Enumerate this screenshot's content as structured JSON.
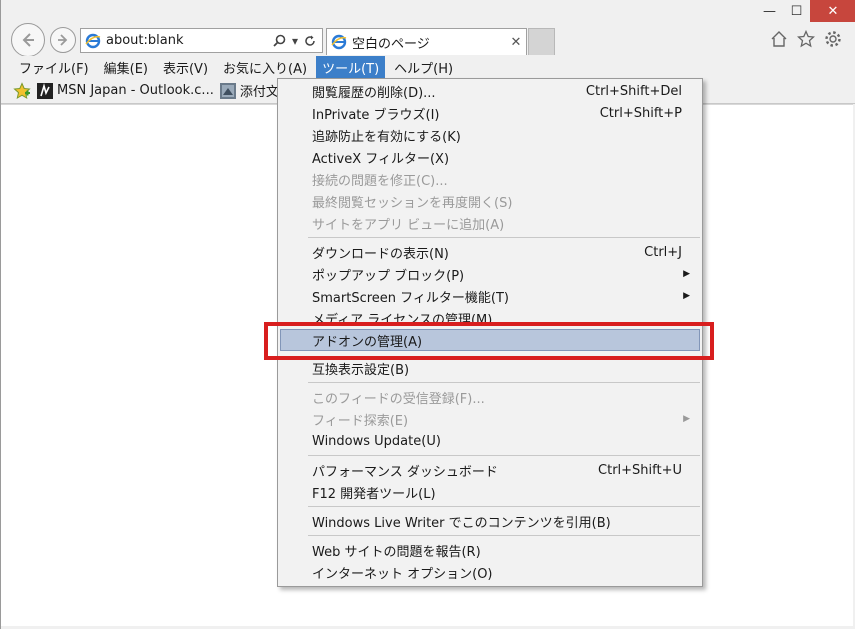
{
  "window": {
    "controls": {
      "minimize": "—",
      "maximize": "☐",
      "close": "✕"
    }
  },
  "address_bar": {
    "url": "about:blank"
  },
  "tab": {
    "title": "空白のページ",
    "close": "✕"
  },
  "menubar": {
    "items": [
      "ファイル(F)",
      "編集(E)",
      "表示(V)",
      "お気に入り(A)",
      "ツール(T)",
      "ヘルプ(H)"
    ]
  },
  "favorites": {
    "items": [
      "MSN Japan - Outlook.c...",
      "添付文書"
    ]
  },
  "tools_menu": {
    "items": [
      {
        "label": "閲覧履歴の削除(D)...",
        "shortcut": "Ctrl+Shift+Del"
      },
      {
        "label": "InPrivate ブラウズ(I)",
        "shortcut": "Ctrl+Shift+P"
      },
      {
        "label": "追跡防止を有効にする(K)",
        "shortcut": ""
      },
      {
        "label": "ActiveX フィルター(X)",
        "shortcut": ""
      },
      {
        "label": "接続の問題を修正(C)...",
        "shortcut": ""
      },
      {
        "label": "最終閲覧セッションを再度開く(S)",
        "shortcut": ""
      },
      {
        "label": "サイトをアプリ ビューに追加(A)",
        "shortcut": ""
      },
      {
        "label": "ダウンロードの表示(N)",
        "shortcut": "Ctrl+J"
      },
      {
        "label": "ポップアップ ブロック(P)",
        "shortcut": ""
      },
      {
        "label": "SmartScreen フィルター機能(T)",
        "shortcut": ""
      },
      {
        "label": "メディア ライセンスの管理(M)",
        "shortcut": ""
      },
      {
        "label": "アドオンの管理(A)",
        "shortcut": ""
      },
      {
        "label": "互換表示設定(B)",
        "shortcut": ""
      },
      {
        "label": "このフィードの受信登録(F)...",
        "shortcut": ""
      },
      {
        "label": "フィード探索(E)",
        "shortcut": ""
      },
      {
        "label": "Windows Update(U)",
        "shortcut": ""
      },
      {
        "label": "パフォーマンス ダッシュボード",
        "shortcut": "Ctrl+Shift+U"
      },
      {
        "label": "F12 開発者ツール(L)",
        "shortcut": ""
      },
      {
        "label": "Windows Live Writer でこのコンテンツを引用(B)",
        "shortcut": ""
      },
      {
        "label": "Web サイトの問題を報告(R)",
        "shortcut": ""
      },
      {
        "label": "インターネット オプション(O)",
        "shortcut": ""
      }
    ]
  },
  "colors": {
    "menu_active": "#3c7fc9",
    "highlight_bg": "#b8c6dc",
    "annotation_red": "#d81e1e",
    "close_button": "#c7463d"
  }
}
